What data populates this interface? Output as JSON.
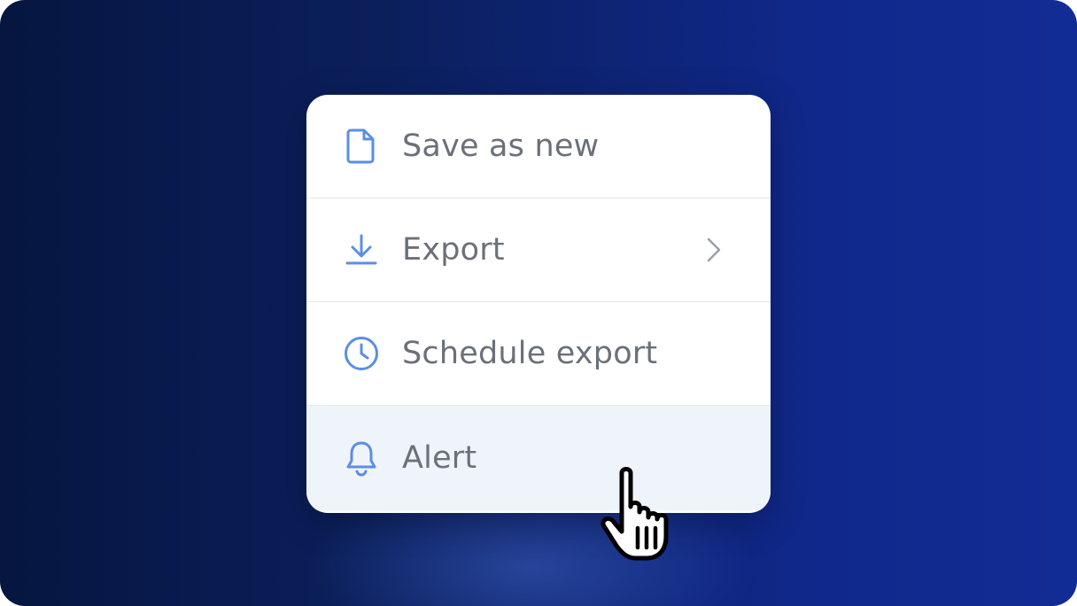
{
  "menu": {
    "items": [
      {
        "label": "Save as new",
        "icon": "file-icon",
        "has_submenu": false,
        "active": false
      },
      {
        "label": "Export",
        "icon": "download-icon",
        "has_submenu": true,
        "active": false
      },
      {
        "label": "Schedule export",
        "icon": "clock-icon",
        "has_submenu": false,
        "active": false
      },
      {
        "label": "Alert",
        "icon": "bell-icon",
        "has_submenu": false,
        "active": true
      }
    ]
  },
  "colors": {
    "icon_accent": "#5b8ee6",
    "label_text": "#6b7079",
    "active_row_bg": "#eff4fa",
    "background_dark": "#061640",
    "background_light": "#122c96"
  },
  "cursor": "pointer-hand-icon"
}
